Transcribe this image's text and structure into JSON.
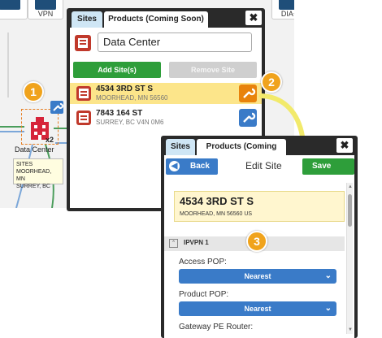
{
  "canvas": {
    "top_icons": [
      {
        "label": "",
        "icon": "network-icon"
      },
      {
        "label": "VPN",
        "icon": "vpn-icon"
      },
      {
        "label": "DIA+",
        "icon": "dia-icon"
      }
    ],
    "site_node": {
      "label": "Data Center",
      "count": "x2"
    },
    "tooltip": {
      "title": "SITES",
      "lines": [
        "MOORHEAD, MN",
        "SURREY, BC"
      ]
    }
  },
  "badges": [
    "1",
    "2",
    "3"
  ],
  "sites_panel": {
    "tabs": [
      "Sites",
      "Products (Coming Soon)"
    ],
    "close_label": "✖",
    "site_name_value": "Data Center",
    "add_button": "Add Site(s)",
    "remove_button": "Remove Site",
    "sites": [
      {
        "address": "4534 3RD ST S",
        "city": "MOORHEAD, MN 56560",
        "selected": true
      },
      {
        "address": "7843 164 ST",
        "city": "SURREY, BC V4N 0M6",
        "selected": false
      }
    ]
  },
  "edit_panel": {
    "tabs": [
      "Sites",
      "Products (Coming Soon)"
    ],
    "close_label": "✖",
    "back_button": "Back",
    "title": "Edit Site",
    "save_button": "Save",
    "address_line1": "4534 3RD ST S",
    "address_line2": "MOORHEAD, MN 56560 US",
    "section_title": "IPVPN 1",
    "fields": [
      {
        "label": "Access POP:",
        "value": "Nearest"
      },
      {
        "label": "Product POP:",
        "value": "Nearest"
      },
      {
        "label": "Gateway PE Router:",
        "value": ""
      }
    ]
  },
  "colors": {
    "accent_blue": "#3a7bc8",
    "green": "#2e9e3a",
    "orange": "#e8830c",
    "badge": "#f0a31c",
    "selected_row": "#fce58a",
    "arrow": "#f2ea6b"
  }
}
